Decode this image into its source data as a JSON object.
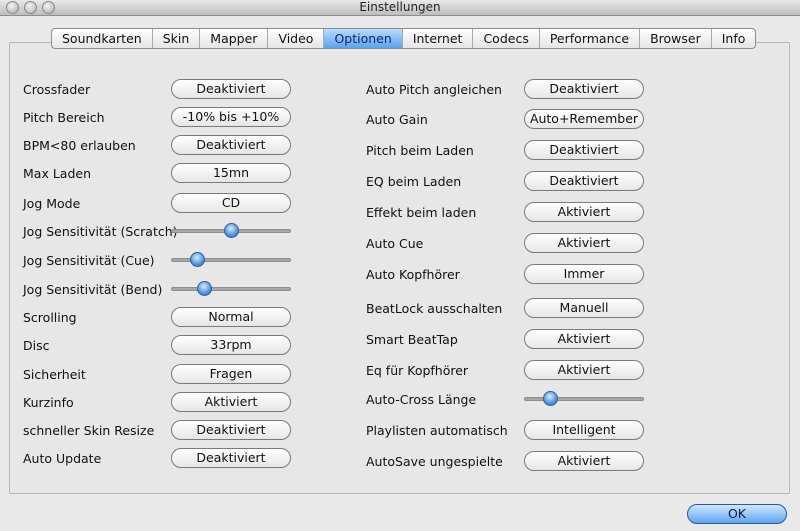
{
  "window": {
    "title": "Einstellungen"
  },
  "tabs": [
    {
      "label": "Soundkarten"
    },
    {
      "label": "Skin"
    },
    {
      "label": "Mapper"
    },
    {
      "label": "Video"
    },
    {
      "label": "Optionen",
      "active": true
    },
    {
      "label": "Internet"
    },
    {
      "label": "Codecs"
    },
    {
      "label": "Performance"
    },
    {
      "label": "Browser"
    },
    {
      "label": "Info"
    }
  ],
  "left": [
    {
      "label": "Crossfader",
      "control": "button",
      "value": "Deaktiviert"
    },
    {
      "label": "Pitch Bereich",
      "control": "button",
      "value": "-10% bis +10%"
    },
    {
      "label": "BPM<80 erlauben",
      "control": "button",
      "value": "Deaktiviert"
    },
    {
      "label": "Max Laden",
      "control": "button",
      "value": "15mn"
    },
    {
      "label": "Jog Mode",
      "control": "button",
      "value": "CD"
    },
    {
      "label": "Jog Sensitivität (Scratch)",
      "control": "slider",
      "level": 0.5
    },
    {
      "label": "Jog Sensitivität (Cue)",
      "control": "slider",
      "level": 0.18
    },
    {
      "label": "Jog Sensitivität (Bend)",
      "control": "slider",
      "level": 0.25
    },
    {
      "label": "Scrolling",
      "control": "button",
      "value": "Normal"
    },
    {
      "label": "Disc",
      "control": "button",
      "value": "33rpm"
    },
    {
      "label": "Sicherheit",
      "control": "button",
      "value": "Fragen"
    },
    {
      "label": "Kurzinfo",
      "control": "button",
      "value": "Aktiviert"
    },
    {
      "label": "schneller Skin Resize",
      "control": "button",
      "value": "Deaktiviert"
    },
    {
      "label": "Auto Update",
      "control": "button",
      "value": "Deaktiviert"
    }
  ],
  "right": [
    {
      "label": "Auto Pitch angleichen",
      "control": "button",
      "value": "Deaktiviert"
    },
    {
      "label": "Auto Gain",
      "control": "button",
      "value": "Auto+Remember"
    },
    {
      "label": "Pitch beim Laden",
      "control": "button",
      "value": "Deaktiviert"
    },
    {
      "label": "EQ beim Laden",
      "control": "button",
      "value": "Deaktiviert"
    },
    {
      "label": "Effekt beim laden",
      "control": "button",
      "value": "Aktiviert"
    },
    {
      "label": "Auto Cue",
      "control": "button",
      "value": "Aktiviert"
    },
    {
      "label": "Auto Kopfhörer",
      "control": "button",
      "value": "Immer"
    },
    {
      "label": "BeatLock ausschalten",
      "control": "button",
      "value": "Manuell"
    },
    {
      "label": "Smart BeatTap",
      "control": "button",
      "value": "Aktiviert"
    },
    {
      "label": "Eq für Kopfhörer",
      "control": "button",
      "value": "Aktiviert"
    },
    {
      "label": "Auto-Cross Länge",
      "control": "slider",
      "level": 0.18
    },
    {
      "label": "Playlisten automatisch",
      "control": "button",
      "value": "Intelligent"
    },
    {
      "label": "AutoSave ungespielte",
      "control": "button",
      "value": "Aktiviert"
    }
  ],
  "footer": {
    "ok_label": "OK"
  }
}
